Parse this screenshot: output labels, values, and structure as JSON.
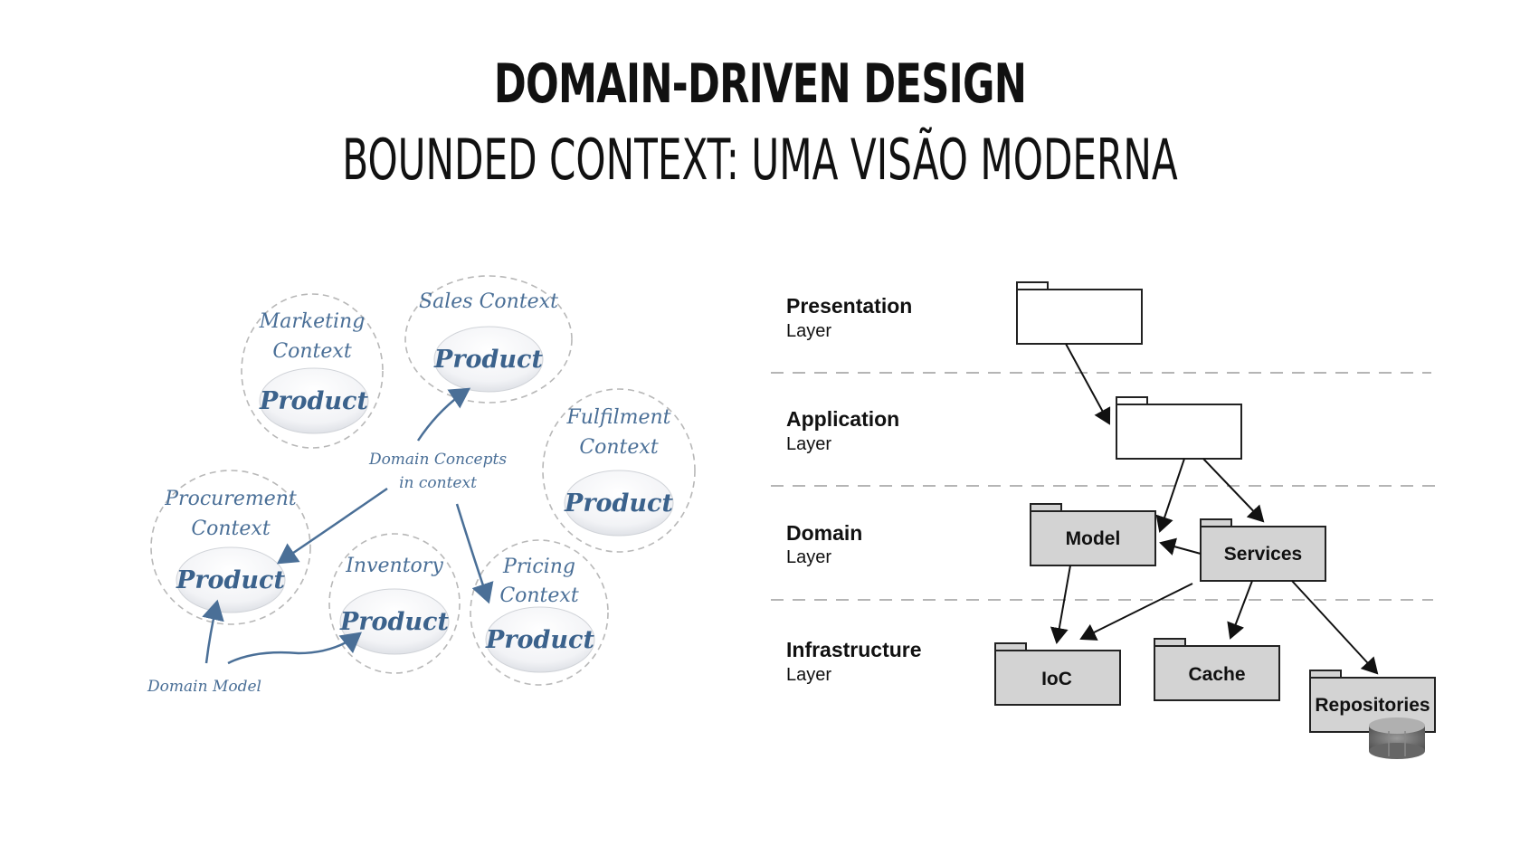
{
  "header": {
    "title": "Domain-Driven Design",
    "subtitle": "Bounded Context: uma visão moderna"
  },
  "contexts_diagram": {
    "contexts": [
      {
        "id": "marketing",
        "line1": "Marketing",
        "line2": "Context",
        "product": "Product"
      },
      {
        "id": "sales",
        "line1": "Sales Context",
        "line2": "",
        "product": "Product"
      },
      {
        "id": "fulfilment",
        "line1": "Fulfilment",
        "line2": "Context",
        "product": "Product"
      },
      {
        "id": "procurement",
        "line1": "Procurement",
        "line2": "Context",
        "product": "Product"
      },
      {
        "id": "inventory",
        "line1": "Inventory",
        "line2": "",
        "product": "Product"
      },
      {
        "id": "pricing",
        "line1": "Pricing",
        "line2": "Context",
        "product": "Product"
      }
    ],
    "center_label_line1": "Domain Concepts",
    "center_label_line2": "in context",
    "domain_model_label": "Domain Model"
  },
  "layers_diagram": {
    "layers": [
      {
        "id": "presentation",
        "name": "Presentation",
        "suffix": "Layer"
      },
      {
        "id": "application",
        "name": "Application",
        "suffix": "Layer"
      },
      {
        "id": "domain",
        "name": "Domain",
        "suffix": "Layer"
      },
      {
        "id": "infrastructure",
        "name": "Infrastructure",
        "suffix": "Layer"
      }
    ],
    "packages": {
      "model": "Model",
      "services": "Services",
      "ioc": "IoC",
      "cache": "Cache",
      "repositories": "Repositories"
    }
  },
  "colors": {
    "context_blue": "#4a6f97",
    "package_fill": "#d3d3d3"
  }
}
